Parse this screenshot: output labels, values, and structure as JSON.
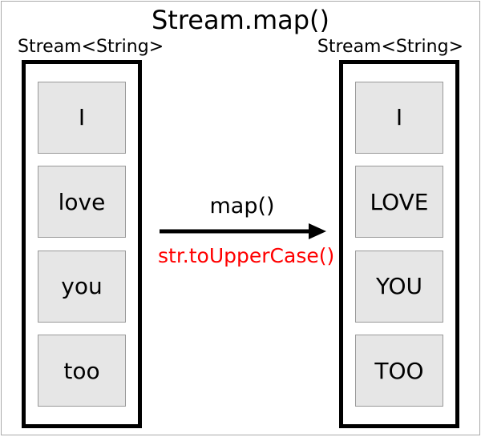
{
  "title": "Stream.map()",
  "left_stream": {
    "label": "Stream<String>",
    "items": [
      "I",
      "love",
      "you",
      "too"
    ]
  },
  "right_stream": {
    "label": "Stream<String>",
    "items": [
      "I",
      "LOVE",
      "YOU",
      "TOO"
    ]
  },
  "operation": {
    "method": "map()",
    "function": "str.toUpperCase()"
  }
}
